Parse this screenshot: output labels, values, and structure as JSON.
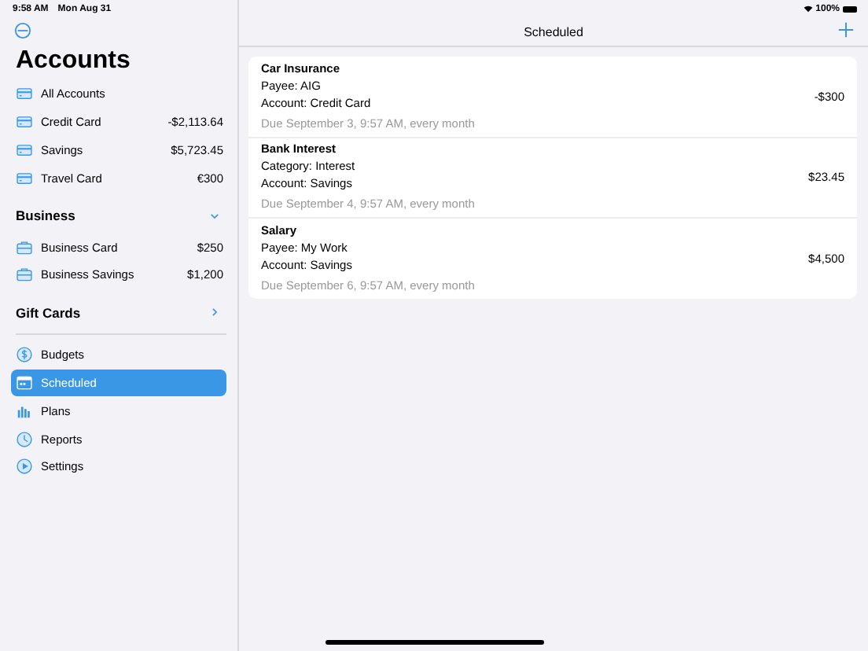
{
  "status_bar": {
    "time": "9:58 AM",
    "date": "Mon Aug 31",
    "battery": "100%"
  },
  "sidebar": {
    "title": "Accounts",
    "accounts": [
      {
        "kind": "card",
        "label": "All Accounts"
      },
      {
        "kind": "card",
        "label": "Credit Card",
        "amount": "-$2,113.64"
      },
      {
        "kind": "card",
        "label": "Savings",
        "amount": "$5,723.45"
      },
      {
        "kind": "card",
        "label": "Travel Card",
        "amount": "€300"
      }
    ],
    "groups": [
      {
        "title": "Business",
        "expanded": true,
        "items": [
          {
            "kind": "briefcase",
            "label": "Business Card",
            "amount": "$250"
          },
          {
            "kind": "briefcase",
            "label": "Business Savings",
            "amount": "$1,200"
          }
        ]
      },
      {
        "title": "Gift Cards",
        "expanded": false
      }
    ],
    "nav": [
      {
        "kind": "dollar",
        "label": "Budgets",
        "selected": false
      },
      {
        "kind": "calendar",
        "label": "Scheduled",
        "selected": true
      },
      {
        "kind": "chart",
        "label": "Plans",
        "selected": false
      },
      {
        "kind": "clock",
        "label": "Reports",
        "selected": false
      },
      {
        "kind": "play",
        "label": "Settings",
        "selected": false
      }
    ]
  },
  "detail": {
    "title": "Scheduled",
    "items": [
      {
        "title": "Car Insurance",
        "line_1": "Payee: AIG",
        "line_2": "Account: Credit Card",
        "due": "Due September 3, 9:57 AM, every month",
        "amount": "-$300"
      },
      {
        "title": "Bank Interest",
        "line_1": "Category: Interest",
        "line_2": "Account: Savings",
        "due": "Due September 4, 9:57 AM, every month",
        "amount": "$23.45"
      },
      {
        "title": "Salary",
        "line_1": "Payee: My Work",
        "line_2": "Account: Savings",
        "due": "Due September 6, 9:57 AM, every month",
        "amount": "$4,500"
      }
    ]
  }
}
